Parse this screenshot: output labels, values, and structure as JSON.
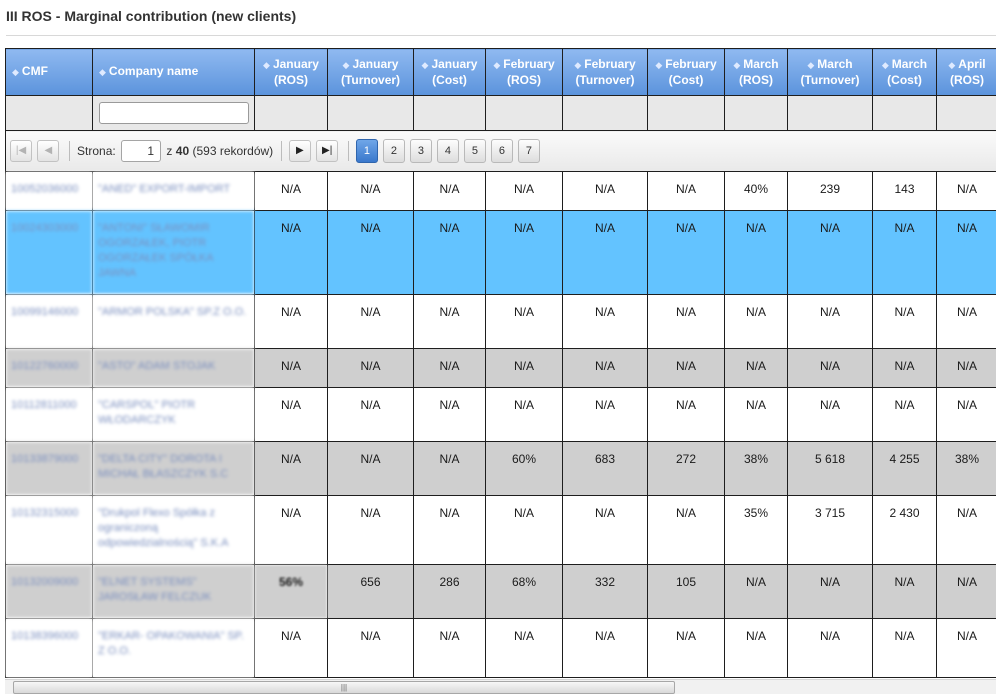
{
  "page": {
    "title": "III ROS - Marginal contribution (new clients)"
  },
  "columns": [
    {
      "label": "CMF"
    },
    {
      "label": "Company name"
    },
    {
      "label": "January\n(ROS)"
    },
    {
      "label": "January\n(Turnover)"
    },
    {
      "label": "January\n(Cost)"
    },
    {
      "label": "February\n(ROS)"
    },
    {
      "label": "February\n(Turnover)"
    },
    {
      "label": "February\n(Cost)"
    },
    {
      "label": "March\n(ROS)"
    },
    {
      "label": "March\n(Turnover)"
    },
    {
      "label": "March\n(Cost)"
    },
    {
      "label": "April\n(ROS)"
    }
  ],
  "pager": {
    "page_label": "Strona:",
    "current_page": "1",
    "of_prefix": "z",
    "total_pages": "40",
    "records": "(593 rekordów)",
    "pages": [
      "1",
      "2",
      "3",
      "4",
      "5",
      "6",
      "7"
    ]
  },
  "rows": [
    {
      "cmf": "10052036000",
      "name": "\"ANED\" EXPORT-IMPORT",
      "values": [
        "N/A",
        "N/A",
        "N/A",
        "N/A",
        "N/A",
        "N/A",
        "40%",
        "239",
        "143",
        "N/A"
      ]
    },
    {
      "cmf": "10024303000",
      "name": "\"ANTONI\" SŁAWOMIR OGORZAŁEK, PIOTR OGORZAŁEK SPÓŁKA JAWNA",
      "values": [
        "N/A",
        "N/A",
        "N/A",
        "N/A",
        "N/A",
        "N/A",
        "N/A",
        "N/A",
        "N/A",
        "N/A"
      ]
    },
    {
      "cmf": "10099146000",
      "name": "\"ARMOR POLSKA\" SP.Z O.O.",
      "values": [
        "N/A",
        "N/A",
        "N/A",
        "N/A",
        "N/A",
        "N/A",
        "N/A",
        "N/A",
        "N/A",
        "N/A"
      ]
    },
    {
      "cmf": "10122760000",
      "name": "\"ASTO\" ADAM STOJAK",
      "values": [
        "N/A",
        "N/A",
        "N/A",
        "N/A",
        "N/A",
        "N/A",
        "N/A",
        "N/A",
        "N/A",
        "N/A"
      ]
    },
    {
      "cmf": "10112811000",
      "name": "\"CARSPOL\" PIOTR WŁODARCZYK",
      "values": [
        "N/A",
        "N/A",
        "N/A",
        "N/A",
        "N/A",
        "N/A",
        "N/A",
        "N/A",
        "N/A",
        "N/A"
      ]
    },
    {
      "cmf": "10133879000",
      "name": "\"DELTA CITY\" DOROTA I MICHAŁ BŁASZCZYK S.C",
      "values": [
        "N/A",
        "N/A",
        "N/A",
        "60%",
        "683",
        "272",
        "38%",
        "5 618",
        "4 255",
        "38%"
      ]
    },
    {
      "cmf": "10132315000",
      "name": "\"Drukpol Flexo Spółka z ograniczoną odpowiedzialnością\" S.K.A",
      "values": [
        "N/A",
        "N/A",
        "N/A",
        "N/A",
        "N/A",
        "N/A",
        "35%",
        "3 715",
        "2 430",
        "N/A"
      ]
    },
    {
      "cmf": "10132009000",
      "name": "\"ELNET SYSTEMS\" JAROSŁAW FELCZUK",
      "values": [
        "56%",
        "656",
        "286",
        "68%",
        "332",
        "105",
        "N/A",
        "N/A",
        "N/A",
        "N/A"
      ]
    },
    {
      "cmf": "10138396000",
      "name": "\"ERKAR- OPAKOWANIA\" SP. Z O.O.",
      "values": [
        "N/A",
        "N/A",
        "N/A",
        "N/A",
        "N/A",
        "N/A",
        "N/A",
        "N/A",
        "N/A",
        "N/A"
      ]
    }
  ]
}
